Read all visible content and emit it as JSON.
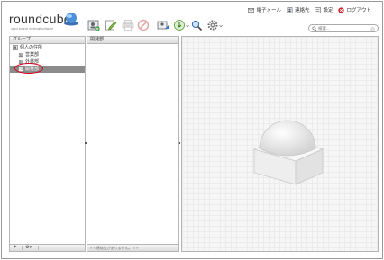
{
  "app": {
    "name": "roundcube",
    "tagline": "open source webmail software"
  },
  "topnav": {
    "items": [
      {
        "label": "電子メール",
        "icon": "mail-icon"
      },
      {
        "label": "連絡先",
        "icon": "addressbook-icon"
      },
      {
        "label": "設定",
        "icon": "settings-icon"
      },
      {
        "label": "ログアウト",
        "icon": "logout-icon"
      }
    ]
  },
  "toolbar": {
    "buttons": [
      {
        "name": "add-contact-button",
        "icon": "add-contact-icon"
      },
      {
        "name": "edit-contact-button",
        "icon": "pencil-icon"
      },
      {
        "name": "print-button",
        "icon": "print-icon"
      },
      {
        "name": "delete-button",
        "icon": "delete-icon"
      },
      {
        "name": "compose-button",
        "icon": "compose-icon"
      },
      {
        "name": "import-button",
        "icon": "import-icon"
      },
      {
        "name": "search-options-button",
        "icon": "magnifier-icon"
      },
      {
        "name": "more-button",
        "icon": "gear-icon"
      }
    ]
  },
  "search": {
    "placeholder": "検索..."
  },
  "groups": {
    "header": "グループ",
    "items": [
      {
        "label": "個人の住所",
        "level": 0,
        "selected": false
      },
      {
        "label": "営業部",
        "level": 1,
        "selected": false
      },
      {
        "label": "外装部",
        "level": 1,
        "selected": false
      },
      {
        "label": "開発部",
        "level": 1,
        "selected": true
      }
    ],
    "footer": {
      "add": "+",
      "menu": "⚙"
    }
  },
  "contacts": {
    "header": "開発部",
    "pager_text": "« < 連絡先がありません。 > »"
  },
  "colors": {
    "selected_row": "#8b8b8b",
    "highlight_ring": "#d9001b"
  }
}
